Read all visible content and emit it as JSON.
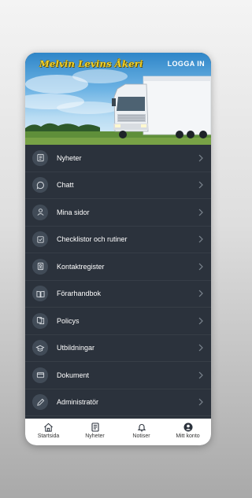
{
  "header": {
    "brand": "Melvin Levins Åkeri",
    "login_label": "LOGGA IN"
  },
  "menu": [
    {
      "label": "Nyheter",
      "icon": "news-icon"
    },
    {
      "label": "Chatt",
      "icon": "chat-bubble-icon"
    },
    {
      "label": "Mina sidor",
      "icon": "person-icon"
    },
    {
      "label": "Checklistor och rutiner",
      "icon": "checkbox-icon"
    },
    {
      "label": "Kontaktregister",
      "icon": "contact-card-icon"
    },
    {
      "label": "Förarhandbok",
      "icon": "book-icon"
    },
    {
      "label": "Policys",
      "icon": "documents-icon"
    },
    {
      "label": "Utbildningar",
      "icon": "graduation-cap-icon"
    },
    {
      "label": "Dokument",
      "icon": "folder-icon"
    },
    {
      "label": "Administratör",
      "icon": "pencil-icon"
    }
  ],
  "tabs": [
    {
      "label": "Startsida",
      "icon": "home-icon"
    },
    {
      "label": "Nyheter",
      "icon": "news-icon"
    },
    {
      "label": "Notiser",
      "icon": "bell-icon"
    },
    {
      "label": "Mitt konto",
      "icon": "account-icon"
    }
  ],
  "colors": {
    "menu_background": "#2b323c",
    "icon_circle": "#414b57",
    "brand_yellow": "#f2d22a",
    "tabbar_background": "#ffffff"
  }
}
